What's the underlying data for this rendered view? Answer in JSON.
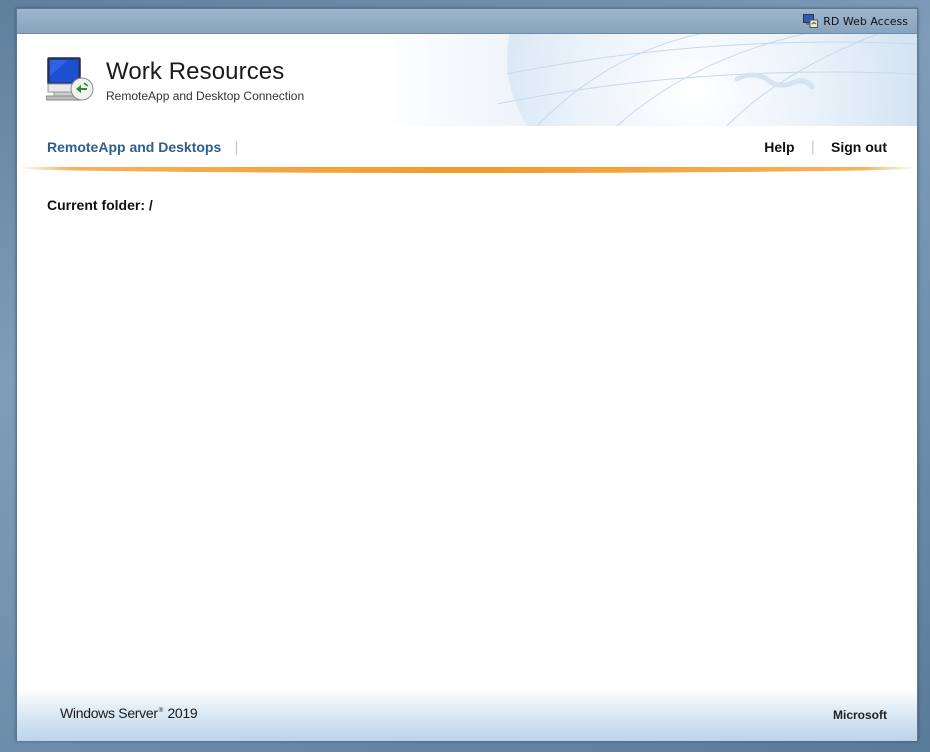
{
  "topbar": {
    "link_label": "RD Web Access",
    "icon": "rd-web-access-icon"
  },
  "header": {
    "title": "Work Resources",
    "subtitle": "RemoteApp and Desktop Connection",
    "logo_icon": "remote-desktop-monitor-icon"
  },
  "nav": {
    "primary_link": "RemoteApp and Desktops",
    "help": "Help",
    "sign_out": "Sign out"
  },
  "content": {
    "current_folder": "Current folder: /"
  },
  "footer": {
    "brand_left": "Windows Server",
    "brand_mark": "®",
    "brand_right": "2019",
    "microsoft": "Microsoft"
  },
  "colors": {
    "accent_orange": "#f39a2a",
    "link_blue": "#2f5d8f",
    "frame_blue": "#8aa7c2"
  }
}
